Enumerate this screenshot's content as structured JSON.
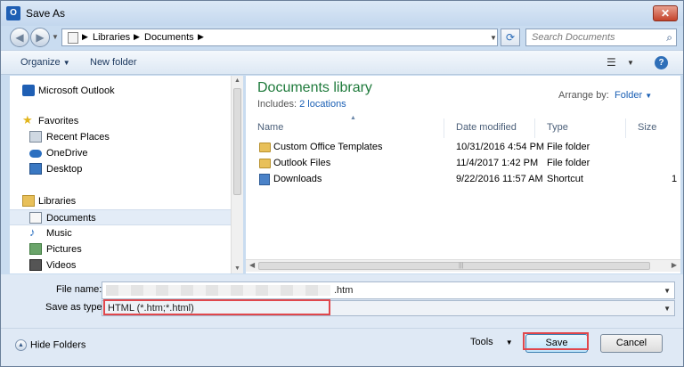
{
  "window": {
    "title": "Save As",
    "app_icon": "outlook-icon",
    "close_icon": "close-icon"
  },
  "address": {
    "crumbs": [
      "Libraries",
      "Documents"
    ],
    "search_placeholder": "Search Documents"
  },
  "toolbar": {
    "organize": "Organize",
    "new_folder": "New folder",
    "help": "?"
  },
  "nav": {
    "items": [
      {
        "label": "Microsoft Outlook",
        "icon": "outlook-icon"
      },
      {
        "label": "Favorites",
        "icon": "star-icon"
      },
      {
        "label": "Recent Places",
        "icon": "recent-places-icon"
      },
      {
        "label": "OneDrive",
        "icon": "onedrive-icon"
      },
      {
        "label": "Desktop",
        "icon": "desktop-icon"
      },
      {
        "label": "Libraries",
        "icon": "libraries-icon"
      },
      {
        "label": "Documents",
        "icon": "documents-icon",
        "selected": true
      },
      {
        "label": "Music",
        "icon": "music-icon"
      },
      {
        "label": "Pictures",
        "icon": "pictures-icon"
      },
      {
        "label": "Videos",
        "icon": "videos-icon"
      }
    ]
  },
  "library": {
    "title": "Documents library",
    "includes_label": "Includes:",
    "includes_link": "2 locations",
    "arrange_label": "Arrange by:",
    "arrange_value": "Folder"
  },
  "columns": [
    "Name",
    "Date modified",
    "Type",
    "Size"
  ],
  "files": [
    {
      "name": "Custom Office Templates",
      "date": "10/31/2016 4:54 PM",
      "type": "File folder",
      "size": "",
      "icon": "folder-icon"
    },
    {
      "name": "Outlook Files",
      "date": "11/4/2017 1:42 PM",
      "type": "File folder",
      "size": "",
      "icon": "folder-icon"
    },
    {
      "name": "Downloads",
      "date": "9/22/2016 11:57 AM",
      "type": "Shortcut",
      "size": "1",
      "icon": "shortcut-icon"
    }
  ],
  "form": {
    "file_name_label": "File name:",
    "file_name_value": ".htm",
    "save_type_label": "Save as type:",
    "save_type_value": "HTML (*.htm;*.html)"
  },
  "footer": {
    "hide_folders": "Hide Folders",
    "tools": "Tools",
    "save": "Save",
    "cancel": "Cancel"
  },
  "colors": {
    "library_title": "#1e7a3b",
    "link": "#1a5fb4",
    "highlight": "#e0474c"
  }
}
